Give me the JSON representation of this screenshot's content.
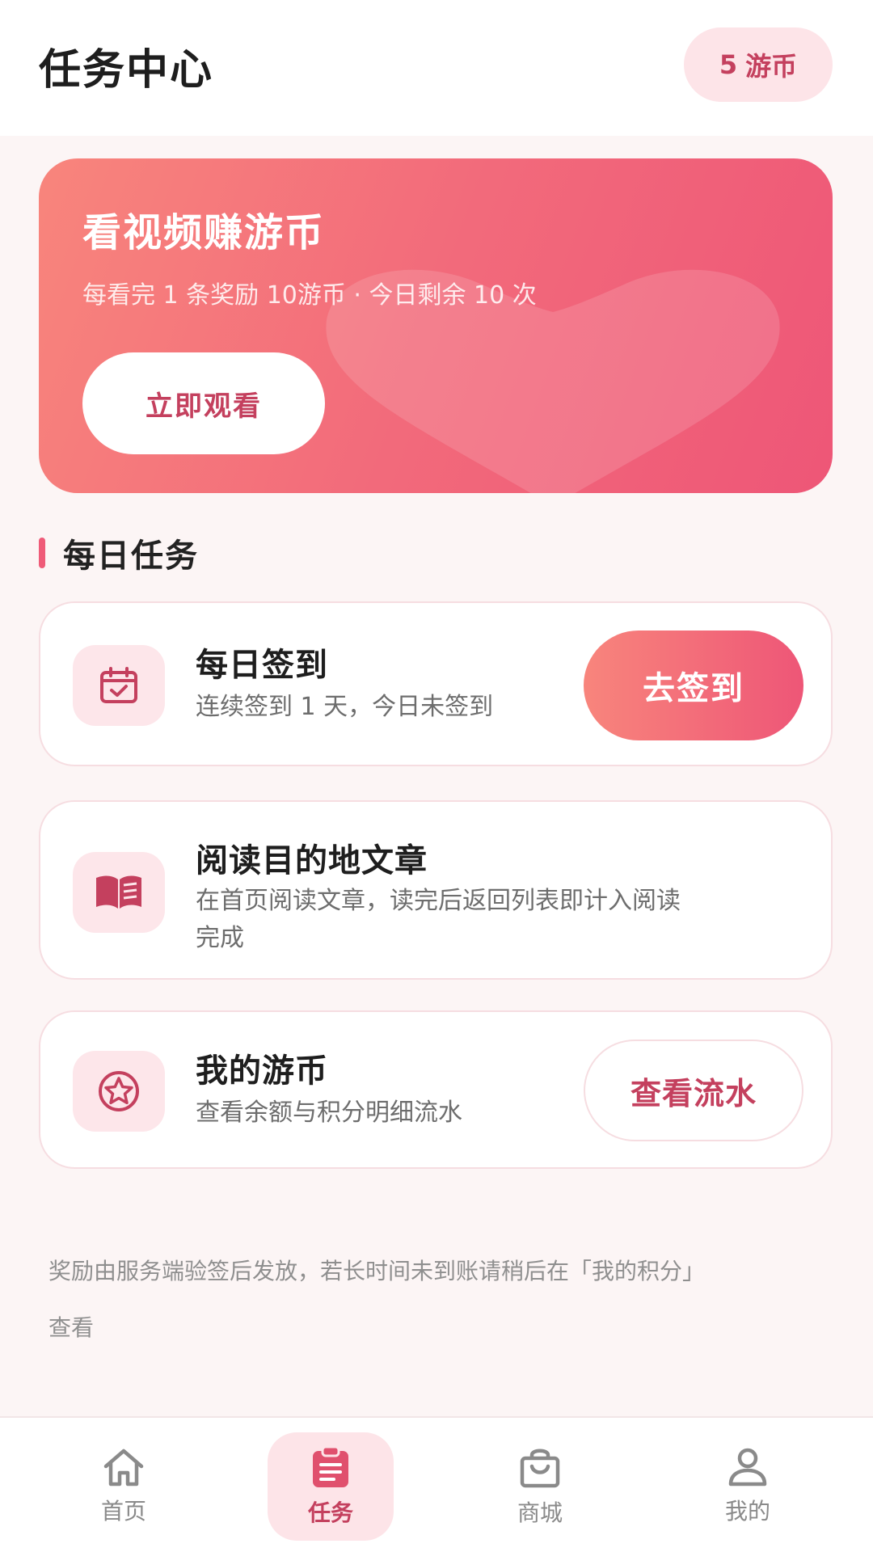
{
  "header": {
    "title": "任务中心",
    "coins_value": "5",
    "coins_unit": "游币"
  },
  "hero": {
    "title": "看视频赚游币",
    "subtitle": "每看完 1 条奖励 10游币 · 今日剩余 10 次",
    "button_label": "立即观看"
  },
  "daily": {
    "section_title": "每日任务",
    "tasks": [
      {
        "title": "每日签到",
        "desc": "连续签到 1 天，今日未签到",
        "icon": "calendar-check-icon",
        "button": "去签到"
      },
      {
        "title": "阅读目的地文章",
        "desc_line1": "在首页阅读文章，读完后返回列表即计入阅读",
        "desc_line2": "完成",
        "icon": "open-book-icon"
      },
      {
        "title": "我的游币",
        "desc": "查看余额与积分明细流水",
        "icon": "star-coin-icon",
        "button": "查看流水"
      }
    ]
  },
  "notice": {
    "line1": "奖励由服务端验签后发放，若长时间未到账请稍后在「我的积分」",
    "line2": "查看"
  },
  "tabbar": {
    "active": "任务",
    "items": [
      {
        "label": "首页",
        "icon": "home-icon"
      },
      {
        "label": "任务",
        "icon": "clipboard-icon"
      },
      {
        "label": "商城",
        "icon": "shopping-bag-icon"
      },
      {
        "label": "我的",
        "icon": "user-icon"
      }
    ]
  },
  "colors": {
    "accent": "#ee5677",
    "accent_dark": "#c4405e",
    "badge_bg": "#fde4e8",
    "page_bg": "#fcf5f5"
  }
}
